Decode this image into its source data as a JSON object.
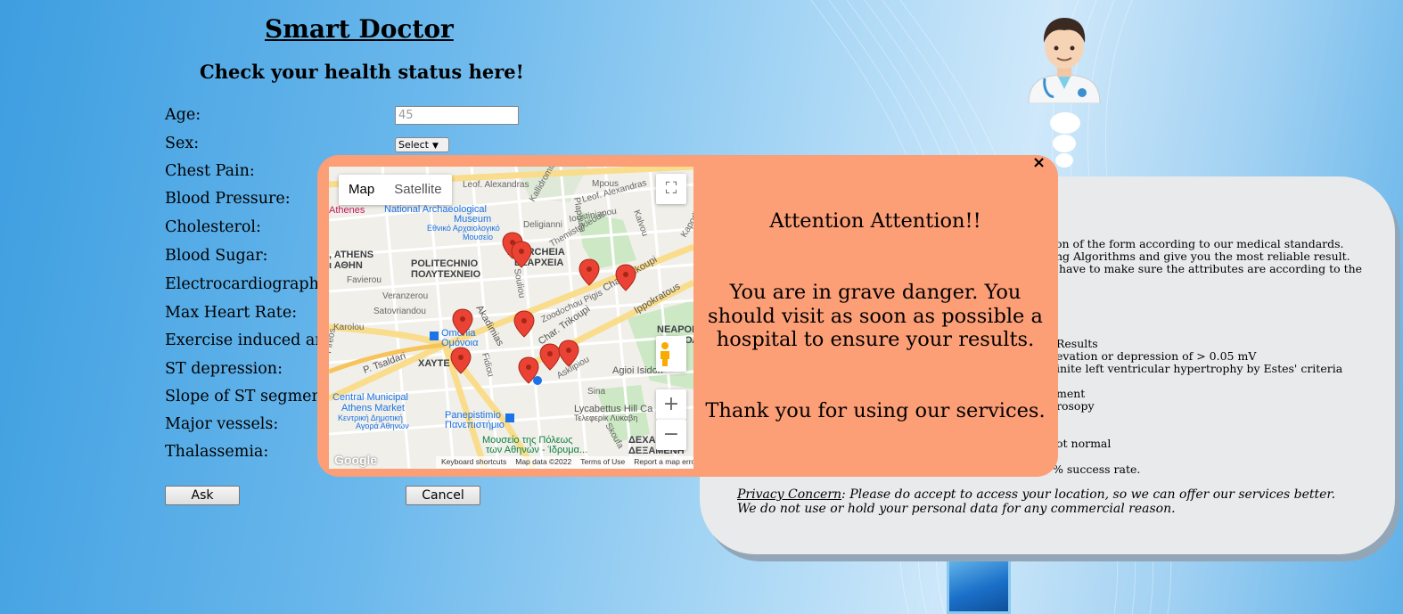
{
  "header": {
    "title": "Smart Doctor",
    "subtitle": "Check your health status here!"
  },
  "form": {
    "labels": {
      "age": "Age:",
      "sex": "Sex:",
      "chest_pain": "Chest Pain:",
      "blood_pressure": "Blood Pressure:",
      "cholesterol": "Cholesterol:",
      "blood_sugar": "Blood Sugar:",
      "ecg": "Electrocardiographic",
      "max_heart_rate": "Max Heart Rate:",
      "exercise_angina": "Exercise induced an",
      "st_depression": "ST depression:",
      "slope": "Slope of ST segment",
      "major_vessels": "Major vessels:",
      "thalassemia": "Thalassemia:"
    },
    "age_value": "45",
    "sex_selected": "Select",
    "ask_label": "Ask",
    "cancel_label": "Cancel"
  },
  "info_panel": {
    "lines": [
      "ion of the form according to our medical standards.",
      "ing Algorithms and give you the most reliable result.",
      "have to make sure the attributes are according to the",
      "Results",
      "evation or depression of > 0.05 mV",
      "inite left ventricular hypertrophy by Estes' criteria",
      "ment",
      "rosopy",
      "ot normal",
      "% success rate."
    ],
    "privacy_title": "Privacy Concern",
    "privacy_text": ": Please do accept to access your location, so we can offer our services better. We do not use or hold your personal data for any commercial reason."
  },
  "modal": {
    "close": "×",
    "attention": "Attention Attention!!",
    "danger": "You are in grave danger. You should visit as soon as possible a hospital to ensure your results.",
    "thanks": "Thank you for using our services."
  },
  "map": {
    "tab_map": "Map",
    "tab_satellite": "Satellite",
    "zoom_in": "+",
    "zoom_out": "−",
    "fullscreen": "⛶",
    "google": "Google",
    "footer": [
      "Keyboard shortcuts",
      "Map data ©2022",
      "Terms of Use",
      "Report a map error"
    ],
    "places": [
      "National Archaeological",
      "Museum",
      "Εθνικό Αρχαιολογικό",
      "Μουσείο",
      "EXARCHEIA",
      "ΕΞΑΡΧΕΙΑ",
      "POLITECHNIO",
      "ΠΟΛΥΤΕΧΝΕΙΟ",
      ", ATHENS",
      "ι ΑΘΗΝ",
      "Omonia",
      "Ομόνοια",
      "NEAPOLI",
      "ΝΕΑΠΟΛ",
      "Central Municipal",
      "Athens Market",
      "Κεντρική Δημοτική",
      "Αγορά Αθηνών",
      "Panepistimio",
      "Πανεπιστήμιο",
      "Μουσείο της Πόλεως",
      "των Αθηνών - Ίδρυμα...",
      "Lycabettus Hill Ca",
      "Τελεφερίκ Λυκαβη",
      "Agioi Isidori",
      "ΔΕΧΑ",
      "ΔΕΞΑΜΕΝΗ",
      "ΧΑΥΤΕ",
      "Athenes"
    ],
    "streets": [
      "Leof. Alexandras",
      "Leof. Alexandras",
      "Mpous",
      "Favierou",
      "Karolou",
      "Satovriandou",
      "Veranzerou",
      "P. Tsaldari",
      "Akadimias",
      "Char. Trikoupi",
      "Char. Trikoupi",
      "Ippokratous",
      "Zoodochou Pigis",
      "Sina",
      "Souliou",
      "Plapouta",
      "Kallidromiou",
      "Themistokleous",
      "Deligianni",
      "Ioustinianou",
      "Kalvou",
      "Asklipiou",
      "Fidiou",
      "Skoufa",
      "Pireos",
      "Kapodistriou"
    ]
  }
}
